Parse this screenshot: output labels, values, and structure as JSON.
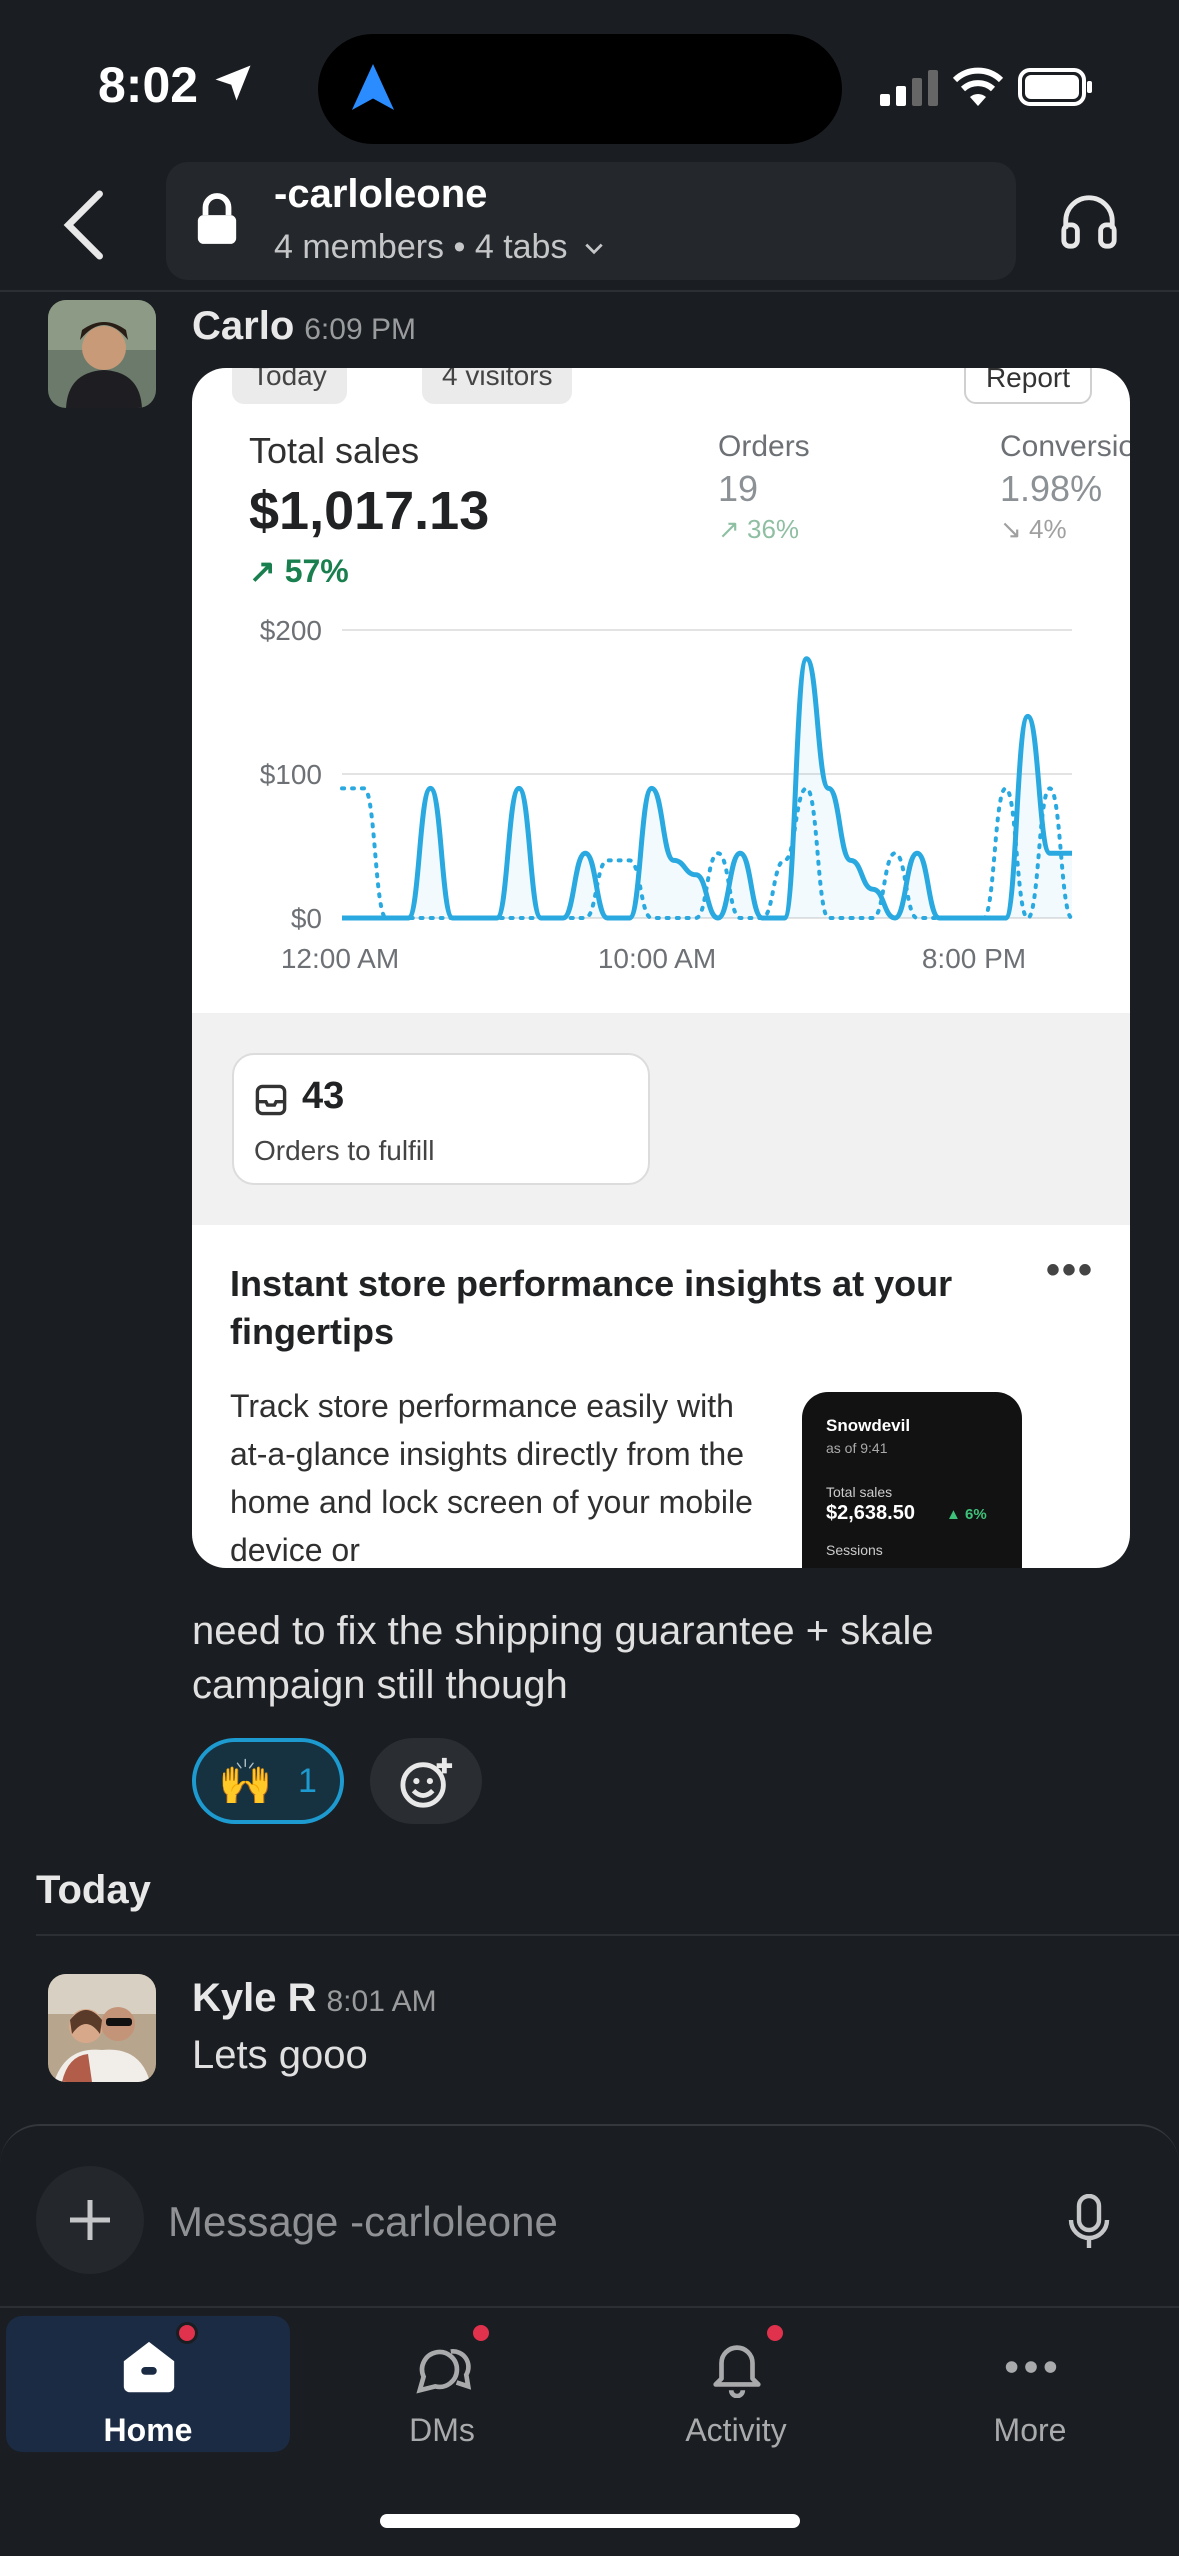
{
  "status_bar": {
    "time": "8:02"
  },
  "header": {
    "channel_name": "-carloleone",
    "channel_sub": "4 members • 4 tabs"
  },
  "message1": {
    "sender": "Carlo",
    "timestamp": "6:09 PM",
    "text": "need to fix the shipping guarantee + skale campaign still though",
    "reaction": {
      "emoji": "🙌",
      "count": "1"
    }
  },
  "embed": {
    "top_pills": [
      "Today",
      "4 visitors"
    ],
    "report_label": "Report",
    "total_sales_label": "Total sales",
    "total_sales_value": "$1,017.13",
    "total_sales_change": "↗ 57%",
    "orders_label": "Orders",
    "orders_value": "19",
    "orders_change": "↗ 36%",
    "conversion_label": "Conversio",
    "conversion_value": "1.98%",
    "conversion_change": "↘ 4%",
    "fulfill_count": "43",
    "fulfill_label": "Orders to fulfill",
    "insight_title": "Instant store performance insights at your fingertips",
    "insight_more": "•••",
    "insight_body": "Track store performance easily with at-a-glance insights directly from the home and lock screen of your mobile device or",
    "phone_widget": {
      "store": "Snowdevil",
      "as_of": "as of 9:41",
      "sales_label": "Total sales",
      "sales_value": "$2,638.50",
      "sales_change": "▲ 6%",
      "sessions_label": "Sessions"
    }
  },
  "chart_data": {
    "type": "line",
    "title": "",
    "ylim": [
      0,
      200
    ],
    "y_ticks": [
      "$200",
      "$100",
      "$0"
    ],
    "x_ticks": [
      "12:00 AM",
      "10:00 AM",
      "8:00 PM"
    ],
    "grid": true,
    "series": [
      {
        "style": "solid",
        "color": "#29a9e0",
        "values": [
          0,
          0,
          0,
          0,
          90,
          0,
          0,
          0,
          90,
          0,
          0,
          45,
          0,
          0,
          90,
          40,
          30,
          0,
          45,
          0,
          0,
          180,
          90,
          40,
          20,
          0,
          45,
          0,
          0,
          0,
          0,
          140,
          45,
          45
        ]
      },
      {
        "style": "dotted",
        "color": "#29a9e0",
        "values": [
          90,
          90,
          0,
          0,
          0,
          0,
          0,
          0,
          0,
          0,
          0,
          0,
          40,
          40,
          0,
          0,
          0,
          45,
          0,
          0,
          40,
          90,
          0,
          0,
          0,
          45,
          0,
          0,
          0,
          0,
          90,
          0,
          90,
          0
        ]
      }
    ]
  },
  "date_divider": "Today",
  "message2": {
    "sender": "Kyle R",
    "timestamp": "8:01 AM",
    "text": "Lets gooo"
  },
  "composer": {
    "placeholder": "Message -carloleone"
  },
  "tabbar": {
    "tabs": [
      {
        "label": "Home"
      },
      {
        "label": "DMs"
      },
      {
        "label": "Activity"
      },
      {
        "label": "More"
      }
    ]
  },
  "colors": {
    "accent": "#1d9bd1",
    "badge": "#e0314d",
    "chart_line": "#29a9e0",
    "positive": "#1a7f4f"
  }
}
